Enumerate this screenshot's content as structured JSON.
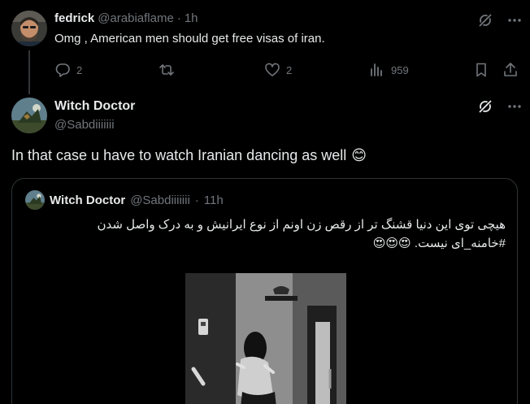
{
  "reply_tweet": {
    "author_name": "fedrick",
    "handle": "@arabiaflame",
    "separator": "·",
    "time": "1h",
    "text": "Omg , American men should get free visas of iran.",
    "counts": {
      "replies": "2",
      "likes": "2",
      "views": "959"
    }
  },
  "main_tweet": {
    "author_name": "Witch Doctor",
    "handle": "@Sabdiiiiiii",
    "text": "In that case u have to watch Iranian dancing as well",
    "emoji": "😊"
  },
  "quoted_tweet": {
    "author_name": "Witch Doctor",
    "handle": "@Sabdiiiiiii",
    "separator": "·",
    "time": "11h",
    "text_line1": "هیچی توی این دنیا قشنگ تر از رقص زن اونم از نوع ایرانیش و به درک واصل شدن",
    "text_line2": "#خامنه_ای نیست. 😍😍😍"
  },
  "colors": {
    "background": "#000000",
    "text": "#e7e9ea",
    "muted": "#71767b",
    "border": "#2f3336"
  },
  "icons": {
    "grok": "grok-icon",
    "more": "more-icon",
    "reply": "reply-icon",
    "retweet": "retweet-icon",
    "like": "like-icon",
    "views": "views-icon",
    "bookmark": "bookmark-icon",
    "share": "share-icon"
  }
}
